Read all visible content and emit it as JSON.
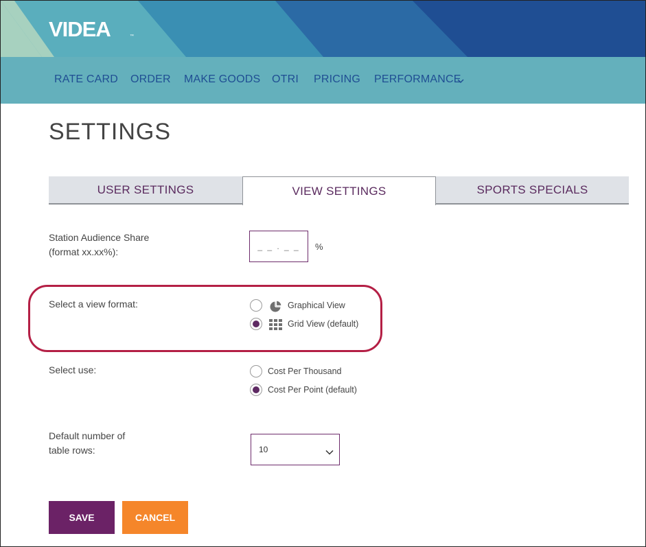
{
  "brand": {
    "logo_text": "VIDEA",
    "trademark": "™"
  },
  "nav": {
    "items": [
      "RATE CARD",
      "ORDER",
      "MAKE GOODS",
      "OTRI",
      "PRICING",
      "PERFORMANCE"
    ]
  },
  "page": {
    "title": "SETTINGS"
  },
  "tabs": [
    {
      "label": "USER SETTINGS",
      "active": false
    },
    {
      "label": "VIEW SETTINGS",
      "active": true
    },
    {
      "label": "SPORTS SPECIALS",
      "active": false
    }
  ],
  "form": {
    "audience_share": {
      "label_line1": "Station Audience Share",
      "label_line2": "(format xx.xx%):",
      "placeholder": "_ _ . _ _",
      "unit": "%"
    },
    "view_format": {
      "label": "Select a view format:",
      "options": [
        {
          "label": "Graphical View",
          "icon": "pie-chart-icon",
          "checked": false
        },
        {
          "label": "Grid View (default)",
          "icon": "grid-icon",
          "checked": true
        }
      ]
    },
    "use": {
      "label": "Select use:",
      "options": [
        {
          "label": "Cost Per Thousand",
          "checked": false
        },
        {
          "label": "Cost Per Point (default)",
          "checked": true
        }
      ]
    },
    "rows": {
      "label_line1": "Default number of",
      "label_line2": "table rows:",
      "value": "10"
    }
  },
  "actions": {
    "save": "SAVE",
    "cancel": "CANCEL"
  },
  "colors": {
    "primary_purple": "#6b2266",
    "cancel_orange": "#f5862a",
    "nav_teal": "#64b0bc",
    "nav_text": "#1f4e93",
    "highlight_red": "#b41f45"
  }
}
